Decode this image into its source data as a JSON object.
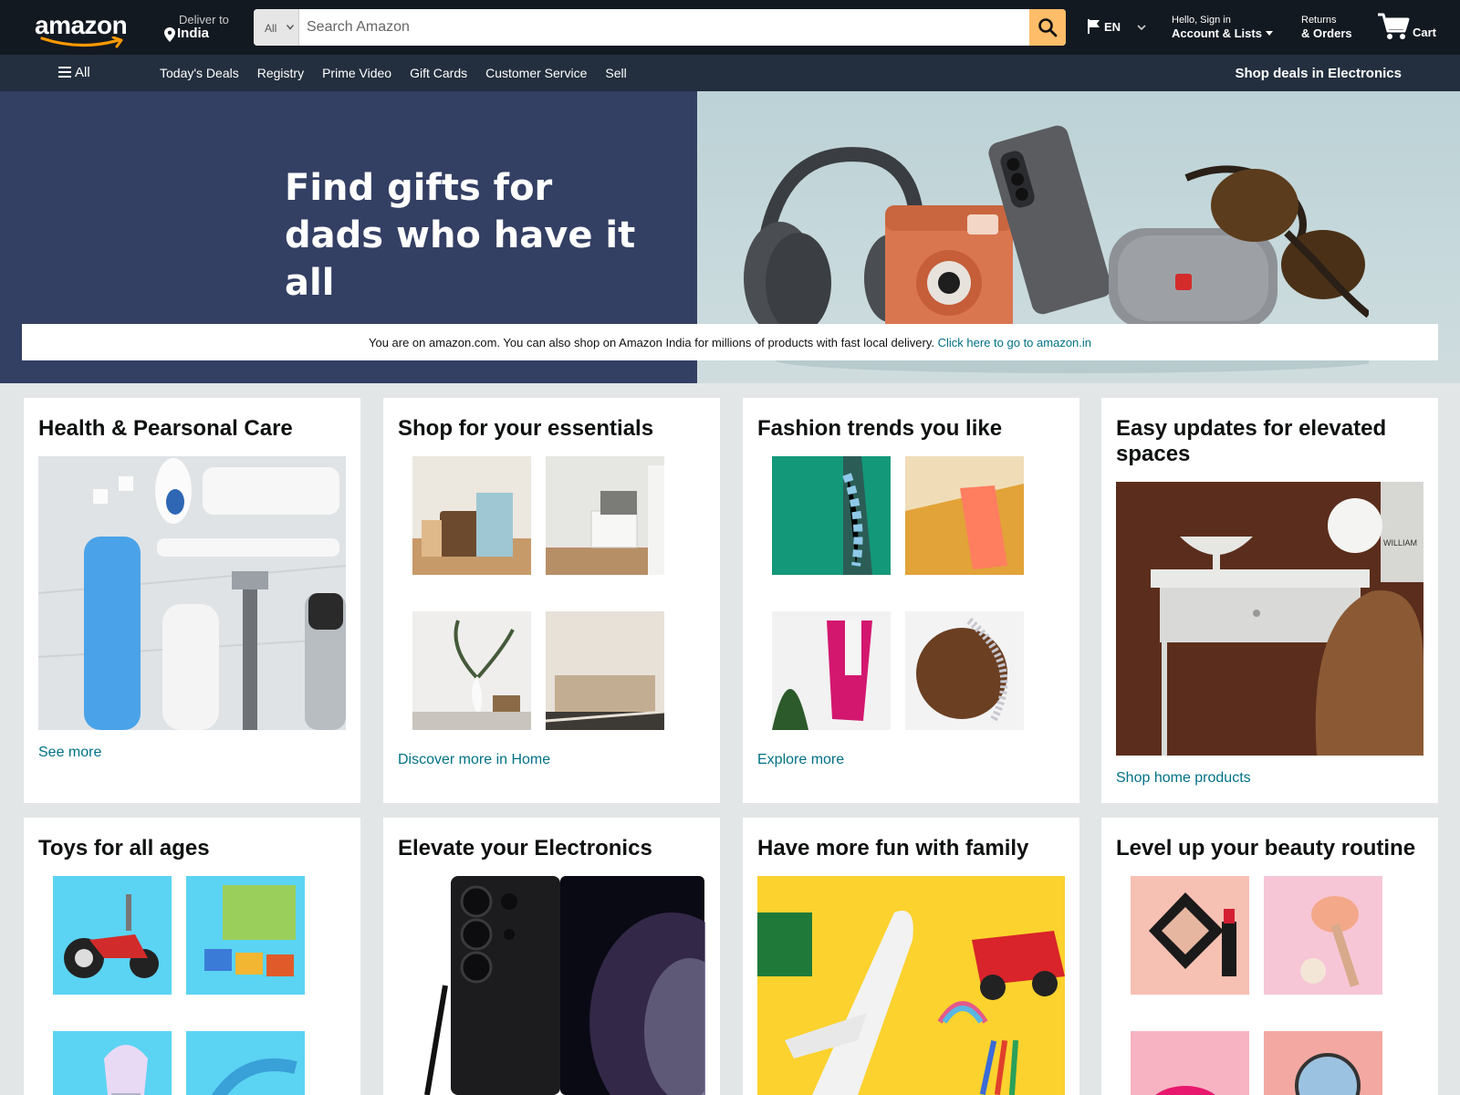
{
  "header": {
    "logo_text": "amazon",
    "deliver_label": "Deliver to",
    "deliver_location": "India",
    "search_category": "All",
    "search_placeholder": "Search Amazon",
    "language": "EN",
    "account_line1": "Hello, Sign in",
    "account_line2": "Account & Lists",
    "orders_line1": "Returns",
    "orders_line2": "& Orders",
    "cart_label": "Cart"
  },
  "subnav": {
    "all_label": "All",
    "links": [
      "Today's Deals",
      "Registry",
      "Prime Video",
      "Gift Cards",
      "Customer Service",
      "Sell"
    ],
    "promo": "Shop deals in Electronics"
  },
  "hero": {
    "title_line1": "Find gifts for",
    "title_line2": "dads who have it all"
  },
  "notice": {
    "text": "You are on amazon.com. You can also shop on Amazon India for millions of products with fast local delivery.",
    "link": "Click here to go to amazon.in"
  },
  "cards": [
    {
      "title": "Health & Pearsonal Care",
      "link": "See more"
    },
    {
      "title": "Shop for your essentials",
      "link": "Discover more in Home"
    },
    {
      "title": "Fashion trends you like",
      "link": "Explore more"
    },
    {
      "title": "Easy updates for elevated spaces",
      "link": "Shop home products",
      "decor_text": "WILLIAM"
    },
    {
      "title": "Toys for all ages"
    },
    {
      "title": "Elevate your Electronics"
    },
    {
      "title": "Have more fun with family"
    },
    {
      "title": "Level up your beauty routine"
    }
  ],
  "colors": {
    "nav_bg": "#131921",
    "subnav_bg": "#232f3e",
    "search_button": "#febd69",
    "link": "#007185",
    "hero_bg": "#333f63",
    "page_bg": "#e3e6e6"
  },
  "icons": [
    "location-pin-icon",
    "chevron-down-icon",
    "search-icon",
    "flag-icon",
    "cart-icon",
    "hamburger-icon"
  ]
}
